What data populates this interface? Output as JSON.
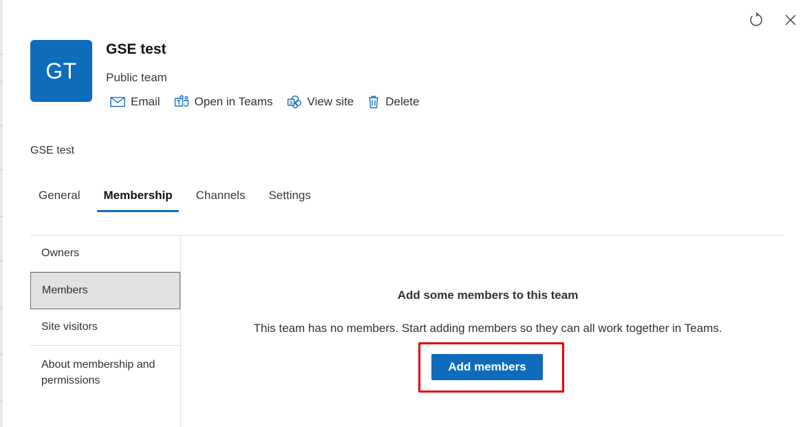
{
  "header": {
    "avatar_initials": "GT",
    "team_name": "GSE test",
    "privacy": "Public team",
    "actions": [
      {
        "label": "Email",
        "icon": "mail-icon"
      },
      {
        "label": "Open in Teams",
        "icon": "teams-icon"
      },
      {
        "label": "View site",
        "icon": "sharepoint-icon"
      },
      {
        "label": "Delete",
        "icon": "trash-icon"
      }
    ],
    "window_icons": [
      "refresh-icon",
      "close-icon"
    ]
  },
  "description": "GSE test",
  "tabs": [
    {
      "label": "General"
    },
    {
      "label": "Membership",
      "active": true
    },
    {
      "label": "Channels"
    },
    {
      "label": "Settings"
    }
  ],
  "side_nav": [
    {
      "label": "Owners"
    },
    {
      "label": "Members",
      "selected": true
    },
    {
      "label": "Site visitors"
    },
    {
      "label": "About membership and permissions"
    }
  ],
  "empty_state": {
    "title": "Add some members to this team",
    "text": "This team has no members. Start adding members so they can all work together in Teams.",
    "button_label": "Add members"
  },
  "colors": {
    "accent": "#0f6cbd",
    "highlight": "#e00000",
    "selected_nav_bg": "#e1e1e1"
  }
}
